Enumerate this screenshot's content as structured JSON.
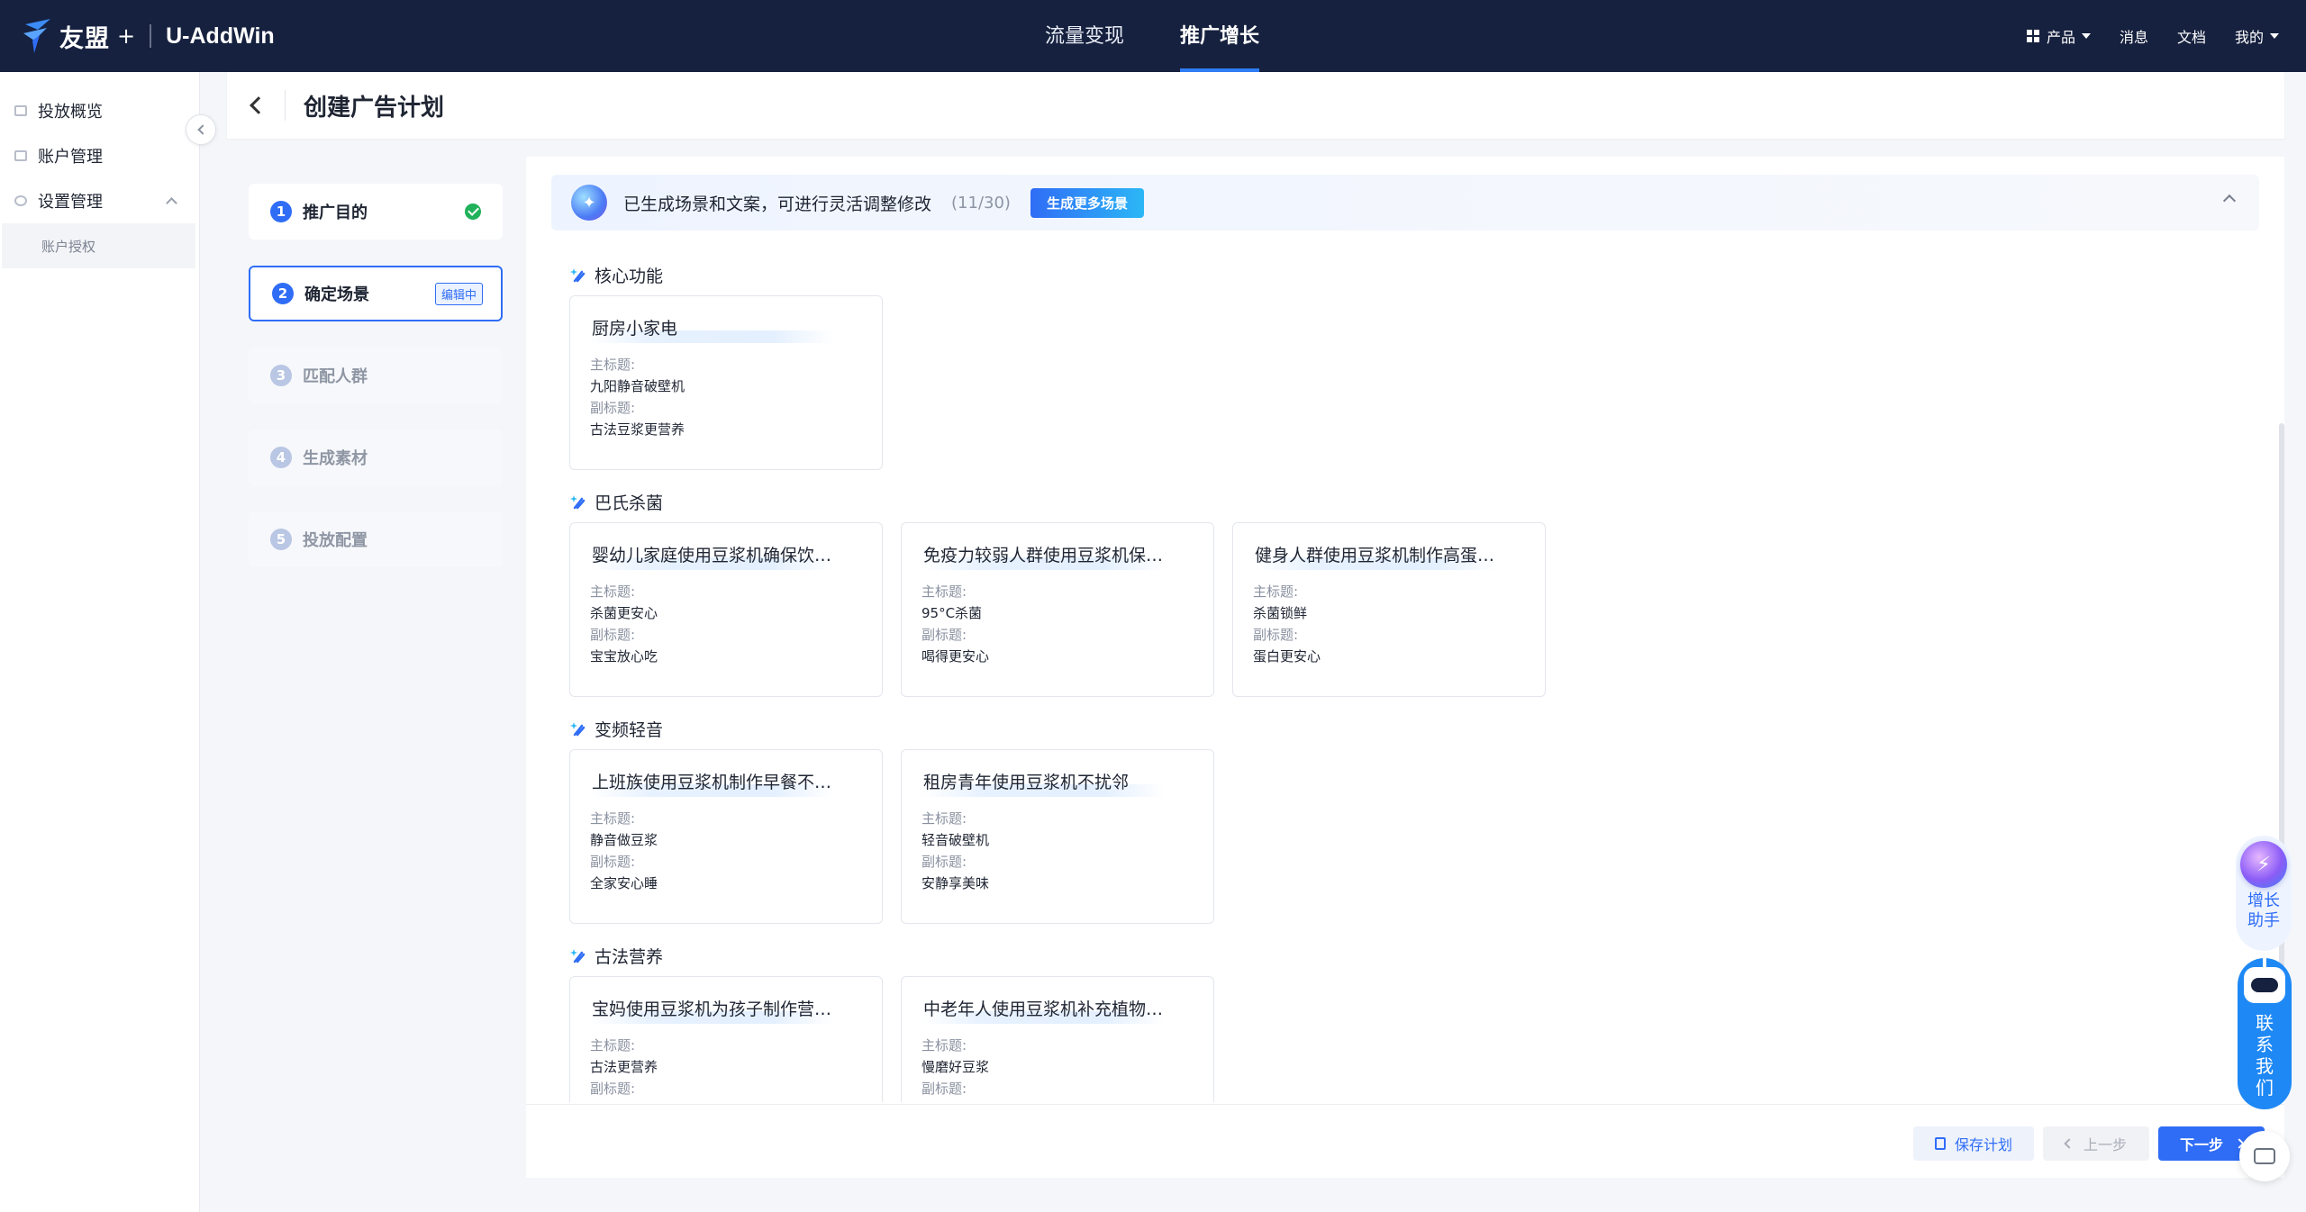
{
  "app": {
    "brand": "友盟",
    "brand_plus": "+",
    "product": "U-AddWin"
  },
  "top_nav": {
    "tabs": [
      {
        "label": "流量变现",
        "active": false
      },
      {
        "label": "推广增长",
        "active": true
      }
    ],
    "right": {
      "product": "产品",
      "messages": "消息",
      "docs": "文档",
      "mine": "我的"
    }
  },
  "sidebar": {
    "items": [
      {
        "label": "投放概览"
      },
      {
        "label": "账户管理"
      },
      {
        "label": "设置管理",
        "expanded": true
      }
    ],
    "sub_items": [
      {
        "label": "账户授权"
      }
    ]
  },
  "page": {
    "title": "创建广告计划"
  },
  "steps": [
    {
      "num": "1",
      "label": "推广目的",
      "state": "done"
    },
    {
      "num": "2",
      "label": "确定场景",
      "state": "active",
      "tag": "编辑中"
    },
    {
      "num": "3",
      "label": "匹配人群",
      "state": "pending"
    },
    {
      "num": "4",
      "label": "生成素材",
      "state": "pending"
    },
    {
      "num": "5",
      "label": "投放配置",
      "state": "pending"
    }
  ],
  "banner": {
    "text": "已生成场景和文案，可进行灵活调整修改",
    "count": "(11/30)",
    "button": "生成更多场景"
  },
  "card_labels": {
    "main_title": "主标题:",
    "sub_title": "副标题:"
  },
  "groups": [
    {
      "title": "核心功能",
      "cards": [
        {
          "name": "厨房小家电",
          "main": "九阳静音破壁机",
          "sub": "古法豆浆更营养"
        }
      ]
    },
    {
      "title": "巴氏杀菌",
      "cards": [
        {
          "name": "婴幼儿家庭使用豆浆机确保饮…",
          "main": "杀菌更安心",
          "sub": "宝宝放心吃"
        },
        {
          "name": "免疫力较弱人群使用豆浆机保…",
          "main": "95°C杀菌",
          "sub": "喝得更安心"
        },
        {
          "name": "健身人群使用豆浆机制作高蛋…",
          "main": "杀菌锁鲜",
          "sub": "蛋白更安心"
        }
      ]
    },
    {
      "title": "变频轻音",
      "cards": [
        {
          "name": "上班族使用豆浆机制作早餐不…",
          "main": "静音做豆浆",
          "sub": "全家安心睡"
        },
        {
          "name": "租房青年使用豆浆机不扰邻",
          "main": "轻音破壁机",
          "sub": "安静享美味"
        }
      ]
    },
    {
      "title": "古法营养",
      "cards": [
        {
          "name": "宝妈使用豆浆机为孩子制作营…",
          "main": "古法更营养",
          "sub": ""
        },
        {
          "name": "中老年人使用豆浆机补充植物…",
          "main": "慢磨好豆浆",
          "sub": ""
        }
      ]
    }
  ],
  "footer": {
    "save": "保存计划",
    "prev": "上一步",
    "next": "下一步"
  },
  "floating": {
    "helper_label": "增长助手",
    "contact_label": "联系我们"
  },
  "colors": {
    "nav_bg": "#16213f",
    "accent": "#2f6df6",
    "success": "#20b15a"
  }
}
